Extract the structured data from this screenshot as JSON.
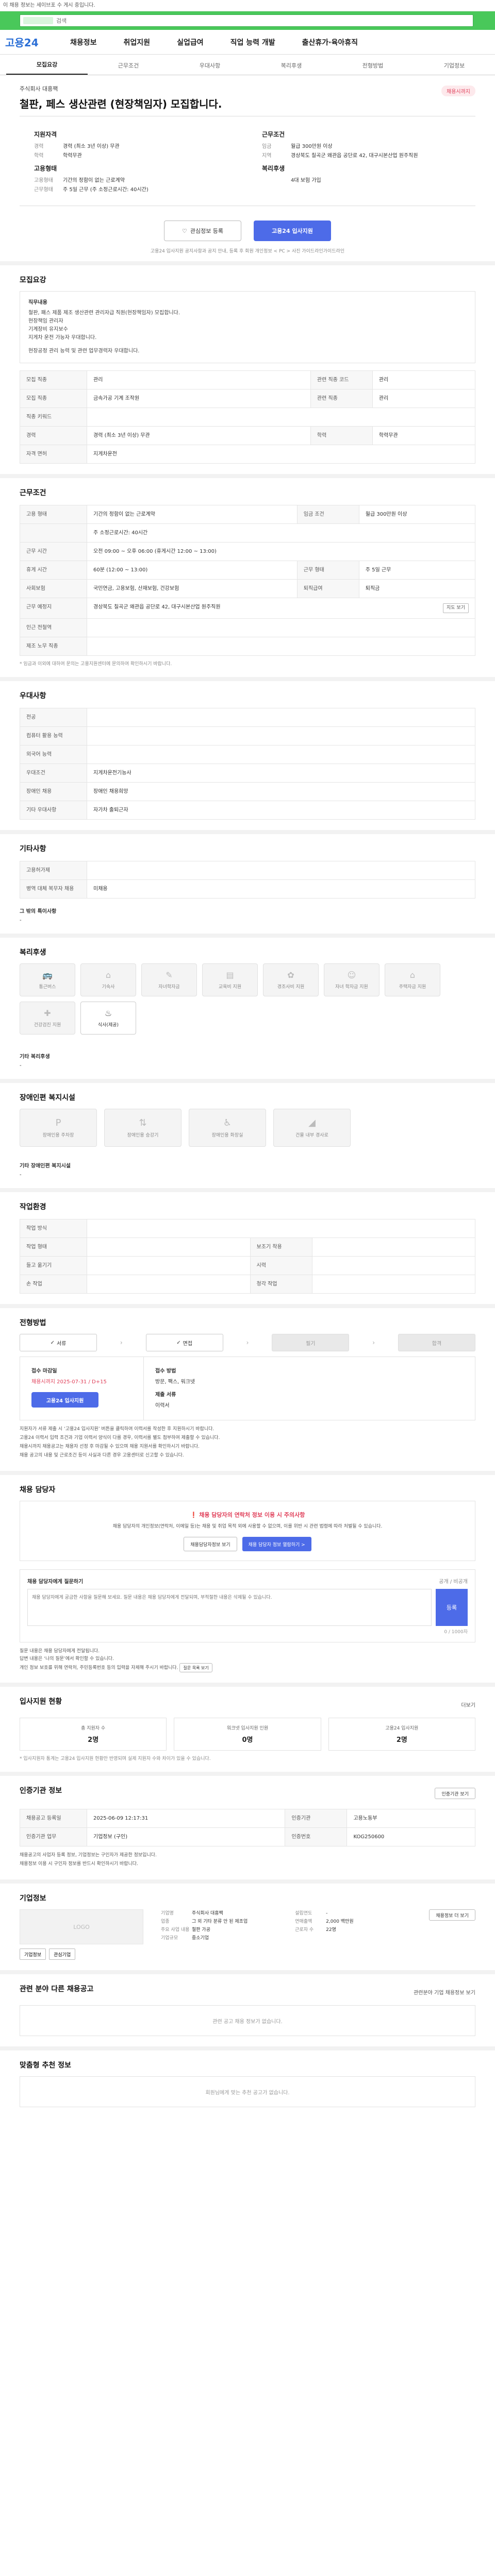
{
  "notice": "이 채용 정보는 세이브포 수 게시 중입니다.",
  "search": {
    "placeholder": "검색"
  },
  "gnb": {
    "logo": "고용24",
    "nav": [
      "채용정보",
      "취업지원",
      "실업급여",
      "직업 능력 개발",
      "출산휴가·육아휴직"
    ]
  },
  "tabs": [
    "모집요강",
    "근무조건",
    "우대사항",
    "복리후생",
    "전형방법",
    "기업정보"
  ],
  "header": {
    "company": "주식회사 대흥팩",
    "title": "철판, 페스 생산관련 (현장책임자) 모집합니다.",
    "badge": "채용시까지"
  },
  "summary": {
    "left_title": "지원자격",
    "left_items": [
      {
        "k": "경력",
        "v": "경력 (최소 3년 이상) 무관"
      },
      {
        "k": "학력",
        "v": "학력무관"
      }
    ],
    "left_title2": "고용형태",
    "left_items2": [
      {
        "k": "고용형태",
        "v": "기간의 정함이 없는 근로계약"
      },
      {
        "k": "근무형태",
        "v": "주 5일 근무 (주 소정근로시간: 40시간)"
      }
    ],
    "right_title": "근무조건",
    "right_items": [
      {
        "k": "임금",
        "v": "월급 300만원 이상"
      },
      {
        "k": "지역",
        "v": "경상북도 칠곡군 왜관읍 공단로 42, 대구시본산업 원주직원"
      }
    ],
    "right_title2": "복리후생",
    "right_items2": [
      {
        "k": "",
        "v": "4대 보험 가입"
      }
    ]
  },
  "actions": {
    "save": "관심정보 등록",
    "apply": "고용24 입사지원",
    "note": "고용24 입사지원 공지사항과 공지 안내, 등록 후 회원 개인정보 < PC > 사진 가이드라인가이드라인"
  },
  "recruit": {
    "section": "모집요강",
    "task_title": "직무내용",
    "task_text": [
      "철판, 패스 제품 제조 생산관련 관리자급 직원(현장책임자) 모집합니다.",
      "현장책임 관리자",
      "기계장비 유지보수",
      "지게차 운전 가능자 우대합니다."
    ],
    "task_extra": "현장공정 관리 능력 및 관련 업무경력자 우대합니다.",
    "rows": [
      {
        "k": "모집 직종",
        "v": "관리",
        "k2": "관련 직종 코드",
        "v2": "관리"
      },
      {
        "k": "모집 직종",
        "v": "금속가공 기계 조작원",
        "k2": "관련 직종",
        "v2": "관리"
      },
      {
        "k": "직종 키워드",
        "v": "",
        "k2": "",
        "v2": ""
      },
      {
        "k": "경력",
        "v": "경력 (최소 3년 이상) 무관",
        "k2": "학력",
        "v2": "학력무관"
      },
      {
        "k": "자격 면허",
        "v": "지게차운전",
        "k2": "",
        "v2": ""
      }
    ]
  },
  "work": {
    "section": "근무조건",
    "rows": [
      {
        "k": "고용 형태",
        "v": "기간의 정함이 없는 근로계약",
        "k2": "임금 조건",
        "v2": "월급 300만원 이상"
      },
      {
        "k": "",
        "v": "주 소정근로시간: 40시간",
        "k2": "",
        "v2": ""
      },
      {
        "k": "근무 시간",
        "v": "오전 09:00 ~ 오후 06:00 (휴게시간 12:00 ~ 13:00)",
        "k2": "",
        "v2": ""
      },
      {
        "k": "휴게 시간",
        "v": "60분 (12:00 ~ 13:00)",
        "k2": "근무 형태",
        "v2": "주 5일 근무"
      },
      {
        "k": "사회보험",
        "v": "국민연금, 고용보험, 산재보험, 건강보험",
        "k2": "퇴직급여",
        "v2": "퇴직금"
      },
      {
        "k": "근무 예정지",
        "v": "경상북도 칠곡군 왜관읍 공단로 42, 대구시본산업 원주직원",
        "k2": "",
        "v2": ""
      },
      {
        "k": "인근 전철역",
        "v": "",
        "k2": "",
        "v2": ""
      },
      {
        "k": "제조 노무 직종",
        "v": "",
        "k2": "",
        "v2": ""
      }
    ],
    "more": "지도 보기",
    "note": "* 임금과 이외에 대하여 문의는 고용지원센터에 문의하여 확인하시기 바랍니다."
  },
  "prefer": {
    "section": "우대사항",
    "rows": [
      {
        "k": "전공",
        "v": ""
      },
      {
        "k": "컴퓨터 활용 능력",
        "v": ""
      },
      {
        "k": "외국어 능력",
        "v": ""
      },
      {
        "k": "우대조건",
        "v": "지게차운전기능사"
      },
      {
        "k": "장애인 채용",
        "v": "장애인 채용희망"
      },
      {
        "k": "기타 우대사항",
        "v": "자가차 출퇴근자"
      }
    ]
  },
  "other": {
    "section": "기타사항",
    "rows": [
      {
        "k": "고용허가제",
        "v": ""
      },
      {
        "k": "병역 대체 복무자 채용",
        "v": "미채용"
      }
    ],
    "extra_label": "그 밖의 특이사항",
    "extra_value": "-"
  },
  "welfare": {
    "section": "복리후생",
    "items": [
      "통근버스",
      "기숙사",
      "자녀학자금",
      "교육비 지원",
      "경조사비 지원",
      "자녀 학자금 지원",
      "주택자금 지원",
      "건강검진 지원",
      "식사(제공)"
    ],
    "extra_label": "기타 복리후생",
    "extra_value": "-"
  },
  "disability": {
    "section": "장애인편 복지시설",
    "items": [
      "장애인용 주차장",
      "장애인용 승강기",
      "장애인용 화장실",
      "건물 내부 경사로"
    ],
    "extra_label": "기타 장애인편 복지시설",
    "extra_value": "-"
  },
  "env": {
    "section": "작업환경",
    "rows": [
      {
        "k": "작업 방식",
        "v": "",
        "k2": "",
        "v2": ""
      },
      {
        "k": "작업 형태",
        "v": "",
        "k2": "보조기 착용",
        "v2": ""
      },
      {
        "k": "들고 옮기기",
        "v": "",
        "k2": "시력",
        "v2": ""
      },
      {
        "k": "손 작업",
        "v": "",
        "k2": "청각 작업",
        "v2": ""
      }
    ]
  },
  "process": {
    "section": "전형방법",
    "steps": [
      "서류",
      "면접",
      "필기",
      "합격"
    ],
    "period_label": "접수 마감일",
    "period_value": "채용시까지 2025-07-31 / D+15",
    "method_label": "접수 방법",
    "method_value": "방문, 팩스, 워크넷",
    "docs_label": "제출 서류",
    "docs_value": "이력서",
    "apply_btn": "고용24 입사지원",
    "bullets": [
      "지원자가 서류 제출 시 ‘고용24 입사지원’ 버튼을 클릭하여 이력서를 작성한 후 지원하시기 바랍니다.",
      "고용24 이력서 입력 조건과 기업 이력서 양식이 다를 경우, 이력서를 별도 첨부하여 제출할 수 있습니다.",
      "채용시까지 채용공고는 채용자 선정 후 마감될 수 있으며 채용 지원서를 확인하시기 바랍니다.",
      "채용 공고의 내용 및 근로조건 등이 사실과 다른 경우 고용센터로 신고할 수 있습니다."
    ]
  },
  "contact": {
    "section": "채용 담당자",
    "warn_title": "채용 담당자의 연락처 정보 이용 시 주의사항",
    "warn_text": "채용 담당자의 개인정보(연락처, 이메일 등)는 채용 및 취업 목적 외에 사용할 수 없으며, 이를 위반 시 관련 법령에 따라 처벌될 수 있습니다.",
    "btn1": "채용담당자정보 보기",
    "btn2": "채용 담당자 정보 열람하기 >",
    "ask_title": "채용 담당자에게 질문하기",
    "ask_right": "공개 / 비공개",
    "ask_placeholder": "채용 담당자에게 궁금한 사항을 질문해 보세요. 질문 내용은 채용 담당자에게 전달되며, 부적절한 내용은 삭제될 수 있습니다.",
    "ask_btn": "등록",
    "ask_count": "0 / 1000자",
    "ask_notes": [
      "질문 내용은 채용 담당자에게 전달됩니다.",
      "답변 내용은 ‘나의 질문’에서 확인할 수 있습니다.",
      "개인 정보 보호를 위해 연락처, 주민등록번호 등의 입력을 자제해 주시기 바랍니다."
    ],
    "ask_more": "질문 목록 보기"
  },
  "stats": {
    "section": "입사지원 현황",
    "link": "더보기",
    "items": [
      {
        "l": "총 지원자 수",
        "n": "2명"
      },
      {
        "l": "워크넷 입사지원 인원",
        "n": "0명"
      },
      {
        "l": "고용24 입사지원",
        "n": "2명"
      }
    ],
    "note": "* 입사지원자 통계는 고용24 입사지원 현황만 반영되며 실제 지원자 수와 차이가 있을 수 있습니다."
  },
  "info": {
    "section": "인증기관 정보",
    "btn": "인증기관 보기",
    "rows": [
      {
        "k": "채용공고 등록일",
        "v": "2025-06-09 12:17:31",
        "k2": "인증기관",
        "v2": "고용노동부"
      },
      {
        "k": "인증기관 업무",
        "v": "기업정보 (구인)",
        "k2": "인증번호",
        "v2": "KOG250600"
      }
    ],
    "notes": [
      "채용공고의 사업자 등록 정보, 기업정보는 구인자가 제공한 정보입니다.",
      "채용정보 이용 시 구인자 정보를 반드시 확인하시기 바랍니다."
    ]
  },
  "corp": {
    "section": "기업정보",
    "logo": "LOGO",
    "btn_left": "기업정보",
    "btn_right": "관심기업",
    "cols": [
      [
        {
          "k": "기업명",
          "v": "주식회사 대흥팩"
        },
        {
          "k": "업종",
          "v": "그 외 기타 분류 안 된 제조업"
        },
        {
          "k": "주요 사업 내용",
          "v": "철판 가공"
        },
        {
          "k": "기업규모",
          "v": "중소기업"
        }
      ],
      [
        {
          "k": "설립연도",
          "v": "-"
        },
        {
          "k": "연매출액",
          "v": "2,000 백만원"
        },
        {
          "k": "근로자 수",
          "v": "22명"
        }
      ]
    ],
    "btn_more": "채용정보 더 보기"
  },
  "similar": {
    "section": "관련 분야 다른 채용공고",
    "right": "관련분야 기업 채용정보 보기",
    "empty": "관련 공고 채용 정보가 없습니다."
  },
  "recommend": {
    "section": "맞춤형 추천 정보",
    "empty": "회원님에게 맞는 추천 공고가 없습니다."
  }
}
